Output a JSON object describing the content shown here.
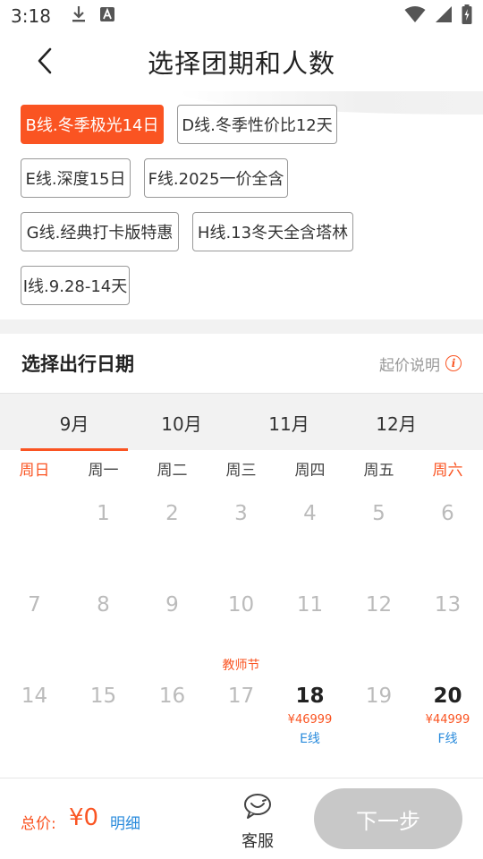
{
  "status_bar": {
    "time": "3:18"
  },
  "header": {
    "title": "选择团期和人数"
  },
  "groups": [
    {
      "label": "B线.冬季极光14日",
      "active": true
    },
    {
      "label": "D线.冬季性价比12天",
      "active": false
    },
    {
      "label": "E线.深度15日",
      "active": false
    },
    {
      "label": "F线.2025一价全含",
      "active": false
    },
    {
      "label": "G线.经典打卡版特惠",
      "active": false
    },
    {
      "label": "H线.13冬天全含塔林",
      "active": false
    },
    {
      "label": "I线.9.28-14天",
      "active": false
    }
  ],
  "date_section": {
    "title": "选择出行日期",
    "price_note": "起价说明"
  },
  "months": [
    {
      "label": "9月",
      "active": true
    },
    {
      "label": "10月",
      "active": false
    },
    {
      "label": "11月",
      "active": false
    },
    {
      "label": "12月",
      "active": false
    }
  ],
  "weekdays": [
    "周日",
    "周一",
    "周二",
    "周三",
    "周四",
    "周五",
    "周六"
  ],
  "calendar": {
    "rows": [
      [
        {
          "day": ""
        },
        {
          "day": "1"
        },
        {
          "day": "2"
        },
        {
          "day": "3"
        },
        {
          "day": "4"
        },
        {
          "day": "5"
        },
        {
          "day": "6"
        }
      ],
      [
        {
          "day": "7"
        },
        {
          "day": "8"
        },
        {
          "day": "9"
        },
        {
          "day": "10",
          "festival": "教师节"
        },
        {
          "day": "11"
        },
        {
          "day": "12"
        },
        {
          "day": "13"
        }
      ],
      [
        {
          "day": "14"
        },
        {
          "day": "15"
        },
        {
          "day": "16"
        },
        {
          "day": "17"
        },
        {
          "day": "18",
          "available": true,
          "price": "¥46999",
          "line": "E线"
        },
        {
          "day": "19"
        },
        {
          "day": "20",
          "available": true,
          "price": "¥44999",
          "line": "F线"
        }
      ]
    ]
  },
  "footer": {
    "total_label": "总价:",
    "total_value": "¥0",
    "detail_label": "明细",
    "service_label": "客服",
    "next_label": "下一步"
  },
  "colors": {
    "accent": "#fa5422",
    "link": "#2a8bdc",
    "disabled_button": "#c8c8c8"
  }
}
